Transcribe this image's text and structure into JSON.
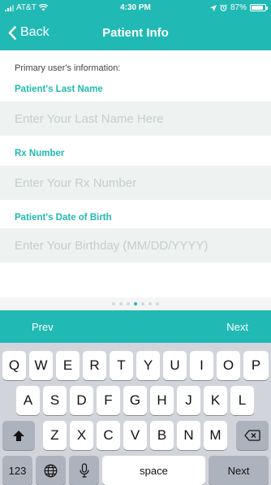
{
  "status_bar": {
    "carrier": "AT&T",
    "time": "4:30 PM",
    "battery_percent": "87%",
    "battery_level": 0.87,
    "icons": [
      "signal-icon",
      "wifi-icon",
      "location-arrow-icon",
      "alarm-icon",
      "battery-icon"
    ]
  },
  "nav": {
    "back_label": "Back",
    "title": "Patient Info"
  },
  "form": {
    "intro": "Primary user's information:",
    "fields": [
      {
        "label": "Patient's Last Name",
        "placeholder": "Enter Your Last Name Here",
        "value": ""
      },
      {
        "label": "Rx Number",
        "placeholder": "Enter Your Rx Number",
        "value": ""
      },
      {
        "label": "Patient's Date of Birth",
        "placeholder": "Enter Your Birthday (MM/DD/YYYY)",
        "value": ""
      }
    ]
  },
  "pager": {
    "total": 7,
    "active_index": 3
  },
  "accessory": {
    "prev_label": "Prev",
    "next_label": "Next"
  },
  "keyboard": {
    "row1": [
      "Q",
      "W",
      "E",
      "R",
      "T",
      "Y",
      "U",
      "I",
      "O",
      "P"
    ],
    "row2": [
      "A",
      "S",
      "D",
      "F",
      "G",
      "H",
      "J",
      "K",
      "L"
    ],
    "row3": [
      "Z",
      "X",
      "C",
      "V",
      "B",
      "N",
      "M"
    ],
    "numbers_label": "123",
    "space_label": "space",
    "return_label": "Next"
  },
  "colors": {
    "accent": "#21b9b4",
    "field_background": "#eef2f0",
    "placeholder": "#c7cecb",
    "keyboard_background": "#d1d5db"
  }
}
